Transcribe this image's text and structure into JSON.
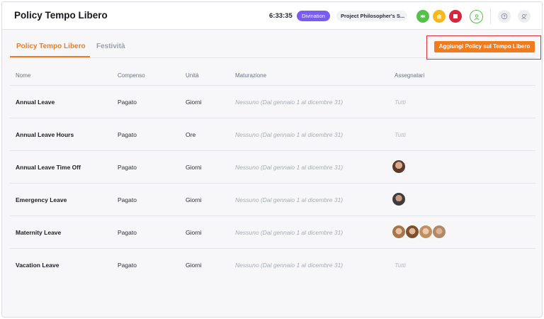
{
  "header": {
    "title": "Policy Tempo Libero",
    "timer": "6:33:35",
    "project": "Divination",
    "task": "Project Philosopher's S..."
  },
  "icons": {
    "green_button": "sync-icon",
    "yellow_button": "hand-icon",
    "red_button": "stop-icon",
    "user_button": "user-icon",
    "help_button": "help-icon",
    "notify_button": "notifications-icon"
  },
  "colors": {
    "accent": "#f07b1f",
    "project_badge": "#7b5cf0",
    "green": "#55c04a",
    "yellow": "#f6b81b",
    "red": "#d7263d",
    "highlight": "#e0303a"
  },
  "tabs": [
    {
      "label": "Policy Tempo Libero",
      "active": true
    },
    {
      "label": "Festività",
      "active": false
    }
  ],
  "add_button": "Aggiungi Policy sul Tempo Libero",
  "table": {
    "columns": [
      "Nome",
      "Compenso",
      "Unità",
      "Maturazione",
      "Assegnatari"
    ],
    "rows": [
      {
        "name": "Annual Leave",
        "comp": "Pagato",
        "unit": "Giorni",
        "accrual": "Nessuno (Dal gennaio 1 al dicembre 31)",
        "assignees": "Tutti",
        "avatars": 0
      },
      {
        "name": "Annual Leave Hours",
        "comp": "Pagato",
        "unit": "Ore",
        "accrual": "Nessuno (Dal gennaio 1 al dicembre 31)",
        "assignees": "Tutti",
        "avatars": 0
      },
      {
        "name": "Annual Leave Time Off",
        "comp": "Pagato",
        "unit": "Giorni",
        "accrual": "Nessuno (Dal gennaio 1 al dicembre 31)",
        "assignees": "",
        "avatars": 1
      },
      {
        "name": "Emergency Leave",
        "comp": "Pagato",
        "unit": "Giorni",
        "accrual": "Nessuno (Dal gennaio 1 al dicembre 31)",
        "assignees": "",
        "avatars": 1
      },
      {
        "name": "Maternity Leave",
        "comp": "Pagato",
        "unit": "Giorni",
        "accrual": "Nessuno (Dal gennaio 1 al dicembre 31)",
        "assignees": "",
        "avatars": 4
      },
      {
        "name": "Vacation Leave",
        "comp": "Pagato",
        "unit": "Giorni",
        "accrual": "Nessuno (Dal gennaio 1 al dicembre 31)",
        "assignees": "Tutti",
        "avatars": 0
      }
    ]
  }
}
